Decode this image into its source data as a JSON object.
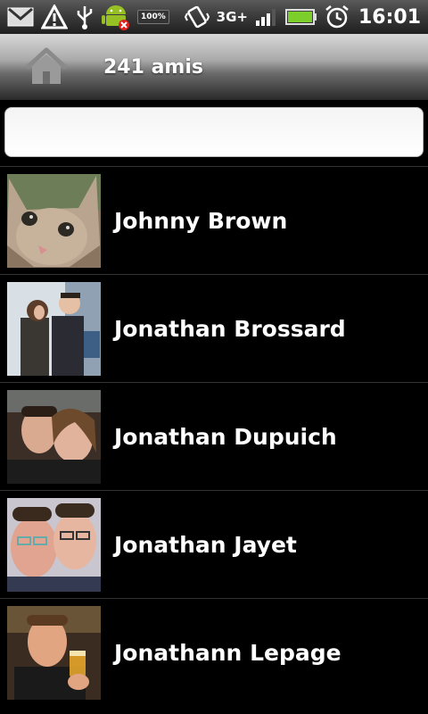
{
  "status_bar": {
    "battery_badge": "100%",
    "network_type": "3G+",
    "time": "16:01",
    "icons": [
      "gmail-icon",
      "alert-icon",
      "usb-icon",
      "android-debug-icon",
      "battery-badge-icon",
      "vibrate-icon",
      "network-3g-icon",
      "signal-icon",
      "battery-icon",
      "alarm-icon"
    ]
  },
  "header": {
    "title": "241 amis",
    "home_icon": "home-icon"
  },
  "search": {
    "value": "",
    "placeholder": ""
  },
  "friends": [
    {
      "name": "Johnny Brown",
      "avatar": "cat-photo"
    },
    {
      "name": "Jonathan Brossard",
      "avatar": "couple-photo"
    },
    {
      "name": "Jonathan Dupuich",
      "avatar": "two-friends-photo"
    },
    {
      "name": "Jonathan Jayet",
      "avatar": "two-men-glasses-photo"
    },
    {
      "name": "Jonathann Lepage",
      "avatar": "man-drinking-photo"
    }
  ],
  "colors": {
    "background": "#000000",
    "battery_green": "#7ccf2a",
    "text": "#ffffff"
  }
}
